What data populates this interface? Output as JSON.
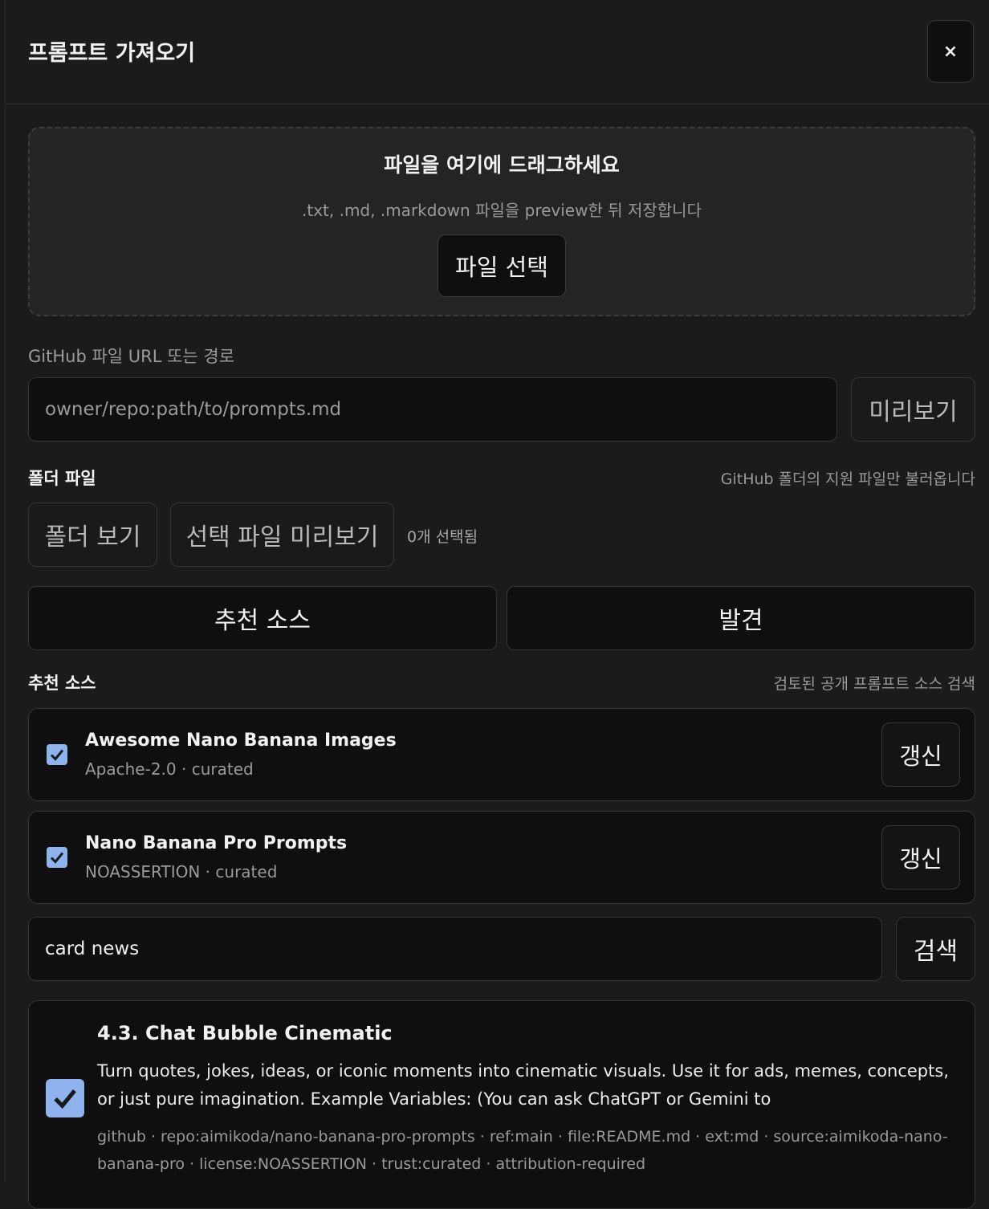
{
  "modal": {
    "title": "프롬프트 가져오기",
    "close_label": "×"
  },
  "dropzone": {
    "title": "파일을 여기에 드래그하세요",
    "subtitle": ".txt, .md, .markdown 파일을 preview한 뒤 저장합니다",
    "file_button": "파일 선택"
  },
  "github": {
    "label": "GitHub 파일 URL 또는 경로",
    "placeholder": "owner/repo:path/to/prompts.md",
    "preview_button": "미리보기"
  },
  "folder": {
    "label": "폴더 파일",
    "hint": "GitHub 폴더의 지원 파일만 불러옵니다",
    "view_button": "폴더 보기",
    "preview_selected_button": "선택 파일 미리보기",
    "selected_count": "0개 선택됨"
  },
  "tabs": [
    {
      "label": "추천 소스"
    },
    {
      "label": "발견"
    }
  ],
  "recommended": {
    "label": "추천 소스",
    "hint": "검토된 공개 프롬프트 소스 검색",
    "sources": [
      {
        "name": "Awesome Nano Banana Images",
        "meta": "Apache-2.0 · curated",
        "checked": true,
        "refresh_label": "갱신"
      },
      {
        "name": "Nano Banana Pro Prompts",
        "meta": "NOASSERTION · curated",
        "checked": true,
        "refresh_label": "갱신"
      }
    ]
  },
  "search": {
    "value": "card news",
    "button": "검색"
  },
  "results": [
    {
      "title": "4.3. Chat Bubble Cinematic",
      "description": "Turn quotes, jokes, ideas, or iconic moments into cinematic visuals. Use it for ads, memes, concepts, or just pure imagination. Example Variables: (You can ask ChatGPT or Gemini to",
      "meta": "github · repo:aimikoda/nano-banana-pro-prompts · ref:main · file:README.md · ext:md · source:aimikoda-nano-banana-pro · license:NOASSERTION · trust:curated · attribution-required",
      "checked": true
    }
  ],
  "colors": {
    "background": "#1b1b1b",
    "surface": "#0f0f0f",
    "checkbox": "#8eb3ee"
  }
}
